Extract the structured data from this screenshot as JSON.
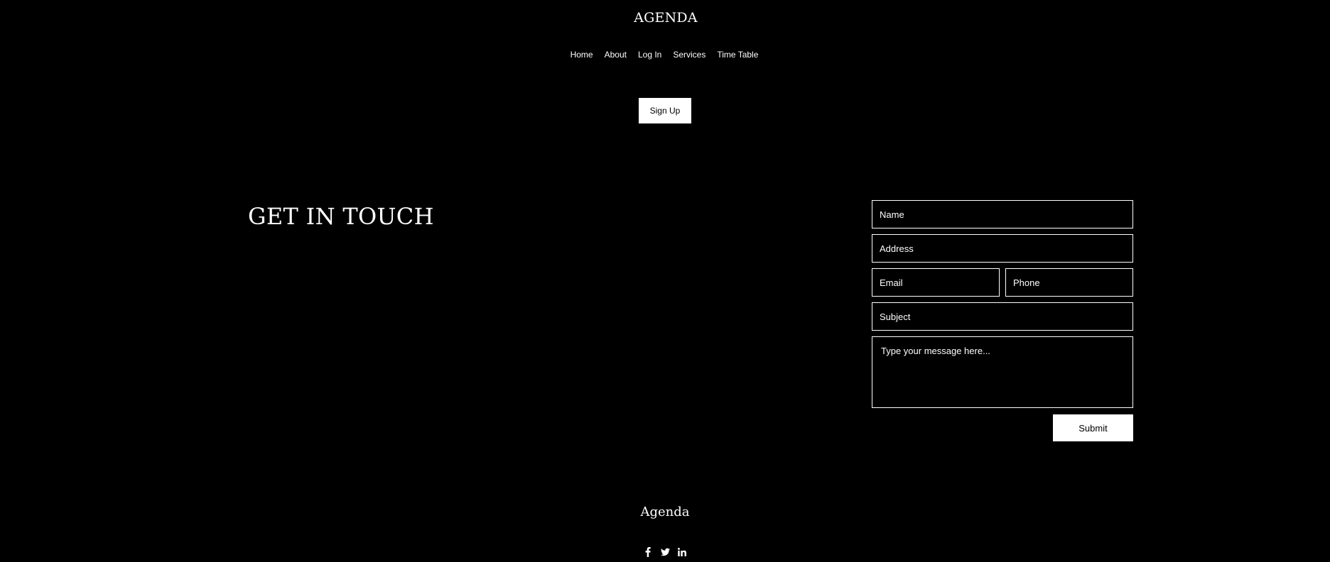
{
  "header": {
    "brand": "AGENDA",
    "nav": [
      {
        "label": "Home"
      },
      {
        "label": "About"
      },
      {
        "label": "Log In"
      },
      {
        "label": "Services"
      },
      {
        "label": "Time Table"
      }
    ],
    "signup_label": "Sign Up"
  },
  "contact": {
    "headline": "GET IN TOUCH",
    "form": {
      "name_placeholder": "Name",
      "address_placeholder": "Address",
      "email_placeholder": "Email",
      "phone_placeholder": "Phone",
      "subject_placeholder": "Subject",
      "message_placeholder": "Type your message here...",
      "submit_label": "Submit"
    }
  },
  "footer": {
    "brand": "Agenda",
    "social": [
      {
        "icon": "facebook-icon"
      },
      {
        "icon": "twitter-icon"
      },
      {
        "icon": "linkedin-icon"
      }
    ]
  },
  "colors": {
    "background": "#000000",
    "foreground": "#ffffff"
  }
}
